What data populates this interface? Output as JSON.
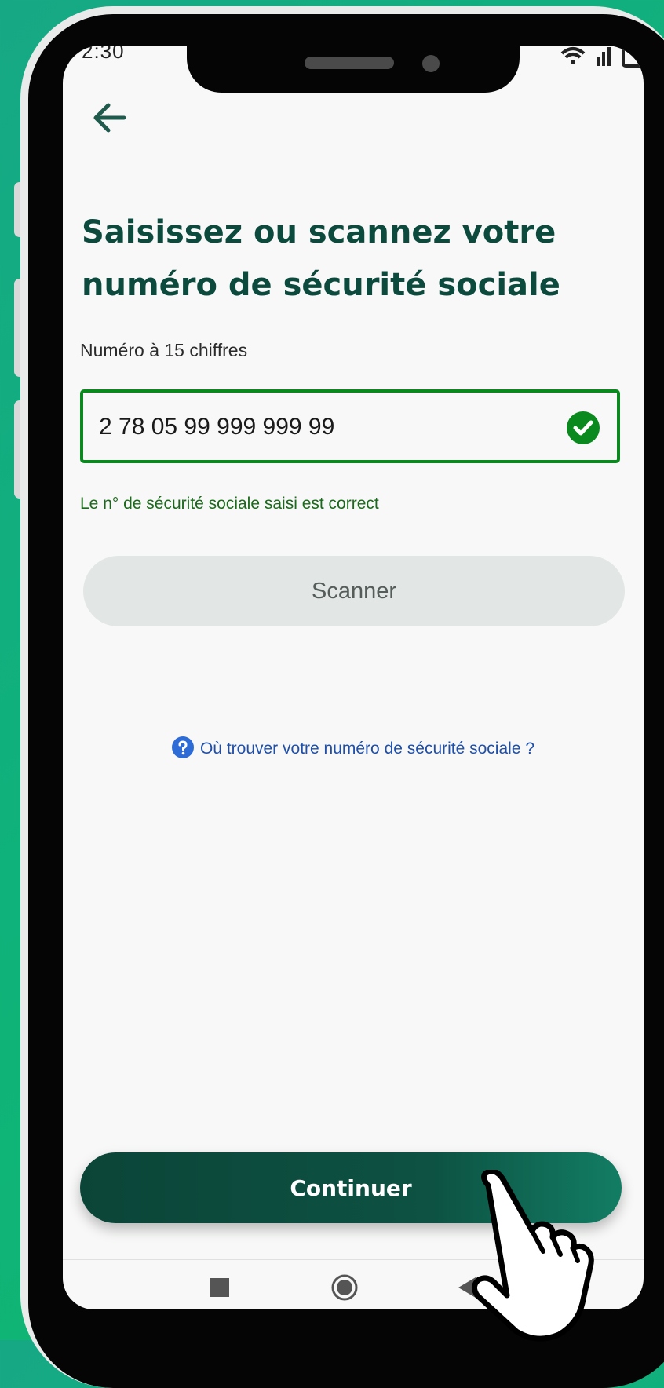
{
  "status_bar": {
    "time": "2:30"
  },
  "header": {
    "title": "Saisissez ou scannez votre numéro de sécurité sociale"
  },
  "form": {
    "label": "Numéro à 15 chiffres",
    "nss_value": "2 78 05 99 999 999 99",
    "validation_message": "Le n° de sécurité sociale saisi est correct",
    "scan_label": "Scanner"
  },
  "help": {
    "link_text": "Où trouver votre numéro de sécurité sociale ?"
  },
  "footer": {
    "continue_label": "Continuer"
  },
  "icons": {
    "back": "arrow-left-icon",
    "valid": "check-circle-icon",
    "help": "question-circle-icon",
    "pointer": "hand-pointer-icon"
  },
  "colors": {
    "background": "#10b37a",
    "title": "#0d4a3e",
    "valid_border": "#0a8a1e",
    "hint": "#1b6a1c",
    "link": "#1f4fa8",
    "continue_bg": "#0b4538",
    "scan_bg": "#e2e6e5"
  }
}
